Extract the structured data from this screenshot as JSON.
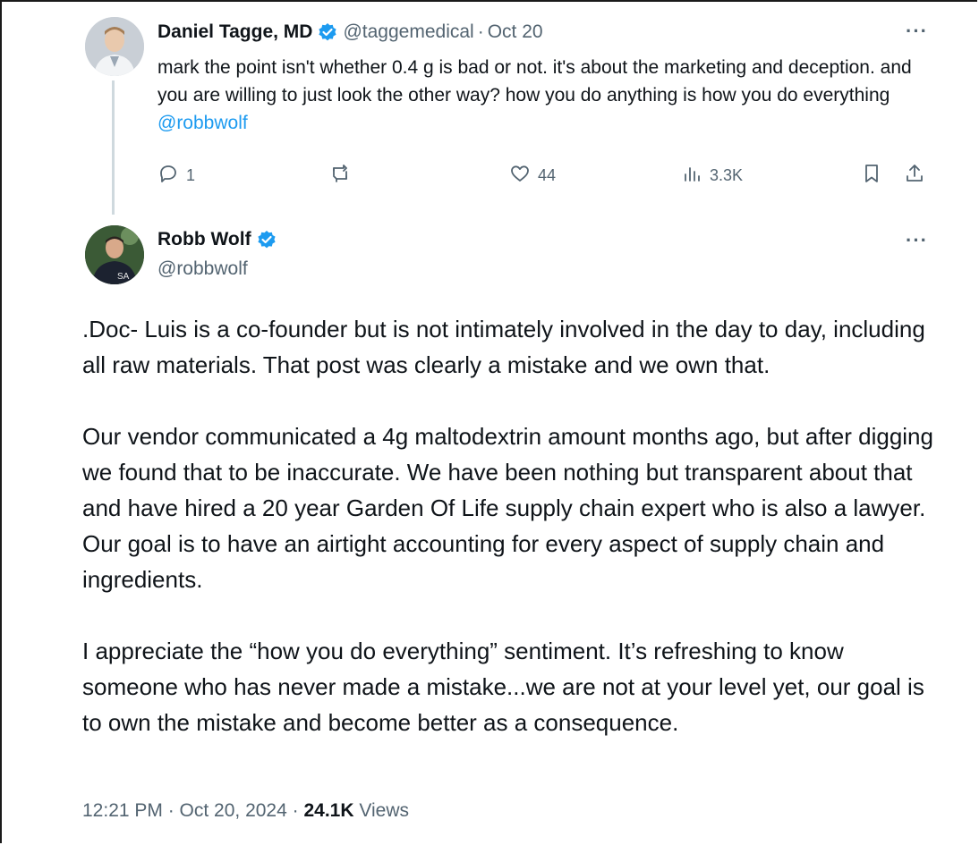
{
  "reply": {
    "author_name": "Daniel Tagge, MD",
    "handle": "@taggemedical",
    "separator": "·",
    "date": "Oct 20",
    "more": "···",
    "text": "mark the point isn't whether 0.4 g is bad or not.  it's about the marketing and deception. and you are willing to just look the other way?  how you do anything is how you do everything ",
    "mention": "@robbwolf",
    "replies": "1",
    "retweets": "",
    "likes": "44",
    "views": "3.3K"
  },
  "main_tweet": {
    "author_name": "Robb Wolf",
    "handle": "@robbwolf",
    "more": "···",
    "paragraphs": [
      ".Doc- Luis is a co-founder but is not intimately involved in the day to day, including all raw materials. That post was clearly a mistake and we own that.",
      "Our vendor communicated a 4g maltodextrin amount months ago, but after digging we found that to be inaccurate. We have been nothing but transparent about that and have hired a 20 year Garden Of Life supply chain expert who is also a lawyer. Our goal is to have an airtight accounting for every aspect of supply chain and ingredients.",
      "I appreciate the “how you do everything” sentiment. It’s refreshing to know someone who has never made a mistake...we are not at your level yet, our goal is to own the mistake and become better as a consequence."
    ],
    "timestamp": "12:21 PM · Oct 20, 2024 · ",
    "view_count": "24.1K",
    "views_label": " Views"
  },
  "icons": {
    "verified": "verified-badge-icon",
    "reply": "reply-icon",
    "retweet": "retweet-icon",
    "like": "heart-icon",
    "views": "analytics-icon",
    "bookmark": "bookmark-icon",
    "share": "share-icon"
  },
  "colors": {
    "verified_blue": "#1d9bf0",
    "secondary_text": "#536471",
    "primary_text": "#0f1419",
    "thread_line": "#cfd9de"
  }
}
